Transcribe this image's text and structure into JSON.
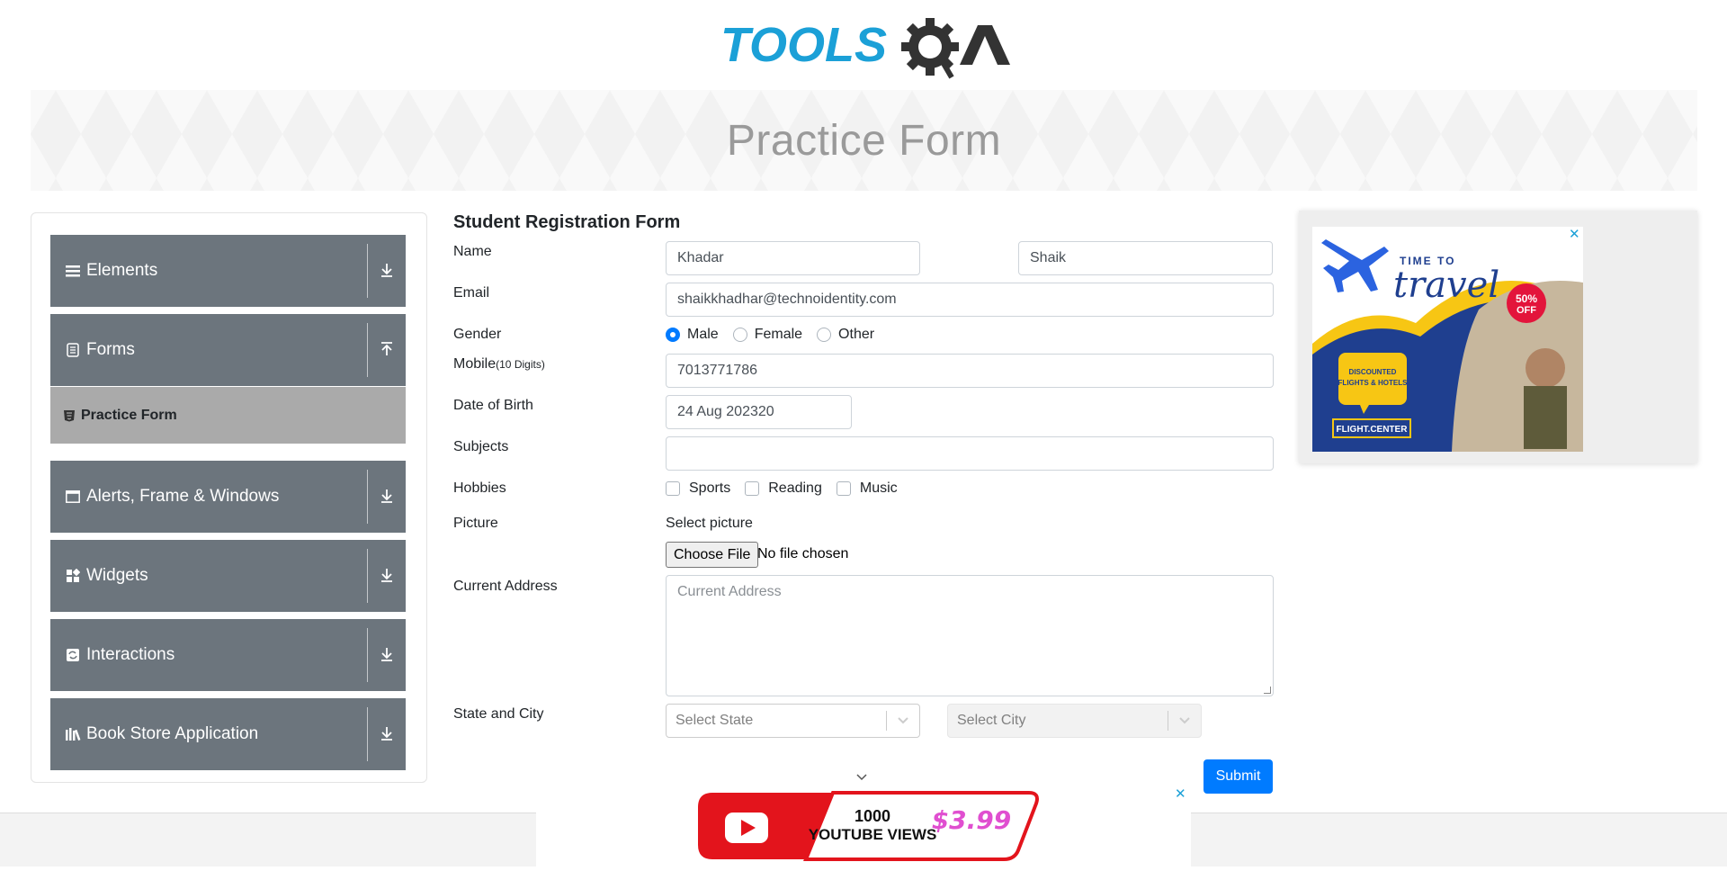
{
  "header": {
    "logo_text_blue": "TOOLS",
    "logo_text_dark": "QA"
  },
  "banner": {
    "title": "Practice Form"
  },
  "sidebar": {
    "groups": [
      {
        "label": "Elements",
        "icon": "menu-icon",
        "expanded": false
      },
      {
        "label": "Forms",
        "icon": "form-icon",
        "expanded": true
      },
      {
        "label": "Alerts, Frame & Windows",
        "icon": "window-icon",
        "expanded": false
      },
      {
        "label": "Widgets",
        "icon": "widgets-icon",
        "expanded": false
      },
      {
        "label": "Interactions",
        "icon": "interactions-icon",
        "expanded": false
      },
      {
        "label": "Book Store Application",
        "icon": "books-icon",
        "expanded": false
      }
    ],
    "active_item": {
      "label": "Practice Form",
      "icon": "html5-icon"
    }
  },
  "form": {
    "title": "Student Registration Form",
    "labels": {
      "name": "Name",
      "email": "Email",
      "gender": "Gender",
      "mobile": "Mobile",
      "mobile_hint": "(10 Digits)",
      "dob": "Date of Birth",
      "subjects": "Subjects",
      "hobbies": "Hobbies",
      "picture": "Picture",
      "address": "Current Address",
      "state_city": "State and City"
    },
    "first_name": "Khadar",
    "last_name": "Shaik",
    "email": "shaikkhadhar@technoidentity.com",
    "gender_options": [
      "Male",
      "Female",
      "Other"
    ],
    "gender_selected": "Male",
    "mobile": "7013771786",
    "dob": "24 Aug 202320",
    "subjects": "",
    "hobby_options": [
      "Sports",
      "Reading",
      "Music"
    ],
    "picture_label": "Select picture",
    "file_button": "Choose File",
    "file_status": "No file chosen",
    "address_placeholder": "Current Address",
    "state_placeholder": "Select State",
    "city_placeholder": "Select City",
    "submit_label": "Submit"
  },
  "ads": {
    "right": {
      "line1": "TIME TO",
      "line2": "travel",
      "badge_pct": "50%",
      "badge_off": "OFF",
      "bubble": "DISCOUNTED FLIGHTS & HOTELS",
      "brand": "FLIGHT.CENTER"
    },
    "bottom": {
      "line1": "1000",
      "line2": "YOUTUBE VIEWS",
      "price": "$3.99"
    },
    "close_glyph": "✕"
  },
  "colors": {
    "accent": "#007bff",
    "sidebar_group": "#6c757d",
    "active_item": "#aaaaaa",
    "logo_blue": "#1ba0d7"
  }
}
